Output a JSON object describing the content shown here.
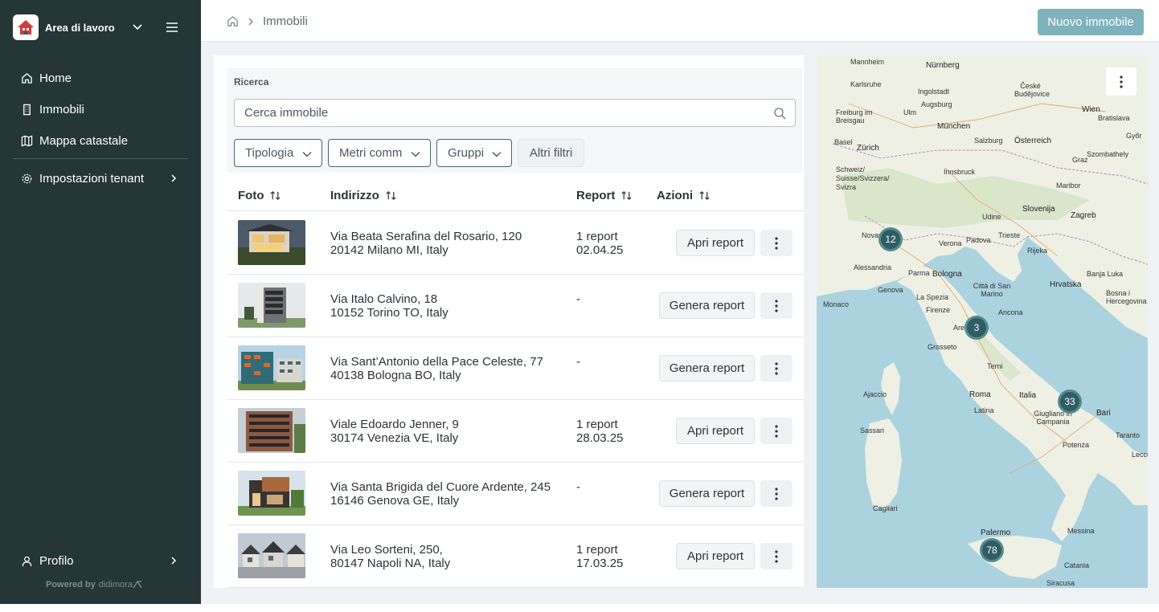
{
  "sidebar": {
    "workspace": {
      "name": "Area di lavoro",
      "logo_icon": "house-logo-icon"
    },
    "nav": [
      {
        "label": "Home",
        "icon": "home-icon"
      },
      {
        "label": "Immobili",
        "icon": "building-icon"
      },
      {
        "label": "Mappa catastale",
        "icon": "map-icon"
      },
      {
        "label": "Impostazioni tenant",
        "icon": "gear-icon"
      }
    ],
    "profile": {
      "label": "Profilo",
      "icon": "user-icon"
    },
    "powered": {
      "prefix": "Powered by",
      "brand": "didimora"
    }
  },
  "topbar": {
    "breadcrumb": [
      "Immobili"
    ],
    "primary_button": "Nuovo immobile"
  },
  "search": {
    "label": "Ricerca",
    "placeholder": "Cerca immobile",
    "filters": [
      "Tipologia",
      "Metri comm",
      "Gruppi"
    ],
    "more_filters": "Altri filtri"
  },
  "table": {
    "columns": [
      "Foto",
      "Indirizzo",
      "Report",
      "Azioni"
    ],
    "rows": [
      {
        "line1": "Via Beata Serafina del Rosario, 120",
        "line2": "20142 Milano MI, Italy",
        "report1": "1 report",
        "report2": "02.04.25",
        "action": "Apri report"
      },
      {
        "line1": "Via Italo Calvino, 18",
        "line2": "10152 Torino TO, Italy",
        "report1": "-",
        "report2": "",
        "action": "Genera report"
      },
      {
        "line1": "Via Sant’Antonio della Pace Celeste, 77",
        "line2": "40138 Bologna BO, Italy",
        "report1": "-",
        "report2": "",
        "action": "Genera report"
      },
      {
        "line1": "Viale Edoardo Jenner, 9",
        "line2": "30174 Venezia VE, Italy",
        "report1": "1 report",
        "report2": "28.03.25",
        "action": "Apri report"
      },
      {
        "line1": "Via Santa Brigida del Cuore Ardente, 245",
        "line2": "16146 Genova GE, Italy",
        "report1": "-",
        "report2": "",
        "action": "Genera report"
      },
      {
        "line1": "Via Leo Sorteni, 250,",
        "line2": "80147 Napoli NA, Italy",
        "report1": "1 report",
        "report2": "17.03.25",
        "action": "Apri report"
      }
    ]
  },
  "map": {
    "clusters": [
      "12",
      "3",
      "33",
      "78"
    ],
    "labels": [
      "Mannheim",
      "Nürnberg",
      "Karlsruhe",
      "Ingolstadt",
      "Augsburg",
      "Ulm",
      "Freiburg im Breisgau",
      "München",
      "Wien",
      "Bratislava",
      "Basel",
      "Zürich",
      "Salzburg",
      "Österreich",
      "Győr",
      "Schweiz/ Suisse/Svizzera/ Svizra",
      "Innsbruck",
      "Graz",
      "Maribor",
      "Slovenija",
      "Zagreb",
      "Udine",
      "Trieste",
      "Novara",
      "Verona",
      "Padova",
      "Rijeka",
      "Alessandria",
      "Parma",
      "Bologna",
      "Genova",
      "La Spezia",
      "Città di San Marino",
      "Hrvatska",
      "Monaco",
      "Firenze",
      "Ancona",
      "Grosseto",
      "Terni",
      "Roma",
      "Italia",
      "Ajaccio",
      "Bari",
      "Latina",
      "Giugliano in Campania",
      "Potenza",
      "Taranto",
      "Sassari",
      "Cagliari",
      "Palermo",
      "Messina",
      "Catania",
      "Siracusa",
      "České Budějovice",
      "Szombathely",
      "Lecce",
      "Banja Luka",
      "Bosna i Hercegovina",
      "Arezzo"
    ],
    "menu_icon": "kebab-icon"
  },
  "colors": {
    "sidebar": "#243635",
    "primary": "#7fb2bb",
    "cluster": "#2f5d64",
    "sea": "#aad3df",
    "land": "#eef0e4"
  }
}
